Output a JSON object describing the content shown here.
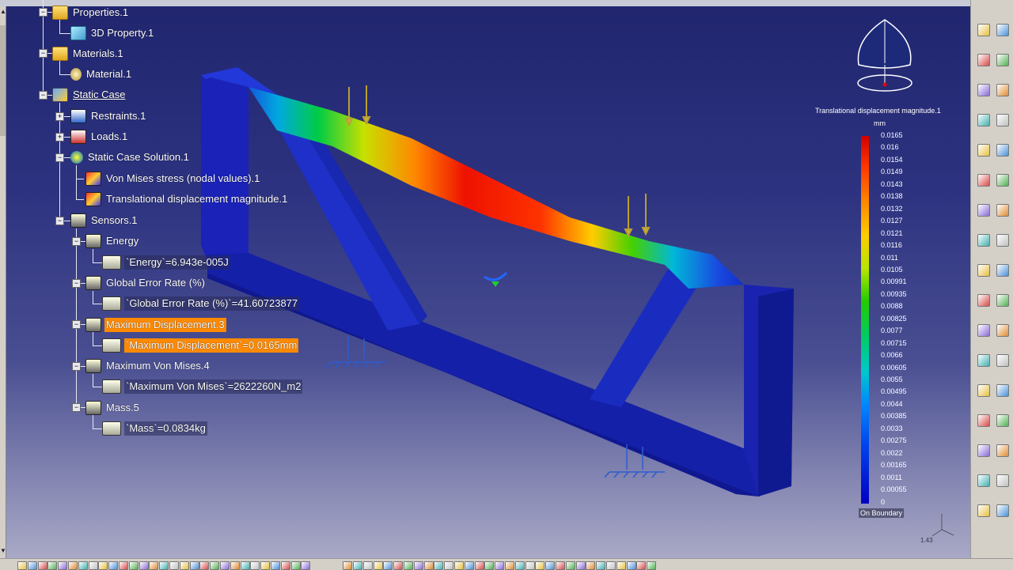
{
  "tree": {
    "properties": "Properties.1",
    "property_3d": "3D Property.1",
    "materials": "Materials.1",
    "material": "Material.1",
    "static_case": "Static Case",
    "restraints": "Restraints.1",
    "loads": "Loads.1",
    "solution": "Static Case Solution.1",
    "von_mises_image": "Von Mises stress (nodal values).1",
    "displacement_image": "Translational displacement magnitude.1",
    "sensors": "Sensors.1",
    "energy": "Energy",
    "energy_value": "`Energy`=6.943e-005J",
    "error_rate": "Global Error Rate (%)",
    "error_rate_value": "`Global Error Rate (%)`=41.60723877",
    "max_disp": "Maximum Displacement.3",
    "max_disp_value": "`Maximum Displacement`=0.0165mm",
    "max_vm": "Maximum Von Mises.4",
    "max_vm_value": "`Maximum Von Mises`=2622260N_m2",
    "mass": "Mass.5",
    "mass_value": "`Mass`=0.0834kg"
  },
  "legend": {
    "title": "Translational displacement magnitude.1",
    "unit": "mm",
    "values": [
      "0.0165",
      "0.016",
      "0.0154",
      "0.0149",
      "0.0143",
      "0.0138",
      "0.0132",
      "0.0127",
      "0.0121",
      "0.0116",
      "0.011",
      "0.0105",
      "0.00991",
      "0.00935",
      "0.0088",
      "0.00825",
      "0.0077",
      "0.00715",
      "0.0066",
      "0.00605",
      "0.0055",
      "0.00495",
      "0.0044",
      "0.00385",
      "0.0033",
      "0.00275",
      "0.0022",
      "0.00165",
      "0.0011",
      "0.00055",
      "0"
    ],
    "footer": "On Boundary"
  },
  "compass": {
    "zoom": "1.43"
  },
  "colors": {
    "highlight": "#ff8a00",
    "background_top": "#20256e",
    "background_bottom": "#a9a9c6"
  }
}
